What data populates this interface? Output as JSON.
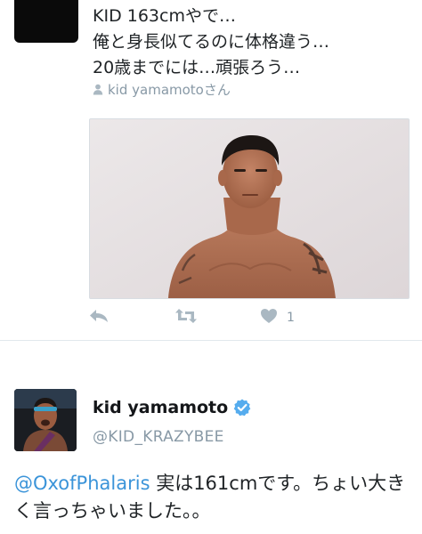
{
  "tweet1": {
    "lines": [
      "KID 163cmやで…",
      "俺と身長似てるのに体格違う…",
      "20歳までには…頑張ろう…"
    ],
    "mention_line": "kid yamamotoさん",
    "actions": {
      "reply_icon": "reply-icon",
      "retweet_icon": "retweet-icon",
      "like_icon": "heart-icon",
      "like_count": "1"
    }
  },
  "tweet2": {
    "name": "kid yamamoto",
    "handle": "@KID_KRAZYBEE",
    "mention": "@OxofPhalaris",
    "text": " 実は161cmです。ちょい大きく言っちゃいました。。"
  },
  "colors": {
    "link": "#3b94d9",
    "muted": "#8899a6",
    "verified": "#55acee"
  }
}
